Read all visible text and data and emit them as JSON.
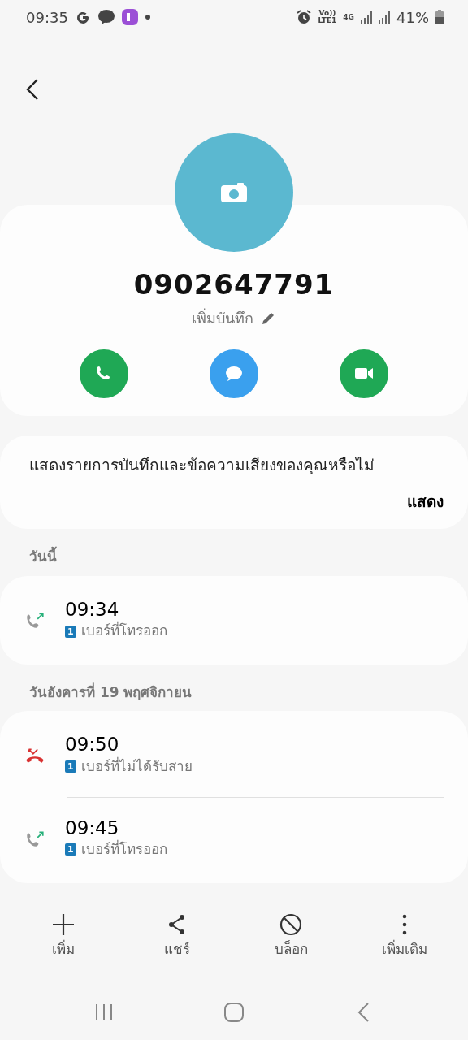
{
  "status_bar": {
    "time": "09:35",
    "volte": "Vo))",
    "lte": "LTE1",
    "network": "4G",
    "battery": "41%"
  },
  "contact": {
    "number": "0902647791",
    "add_note": "เพิ่มบันทึก"
  },
  "actions": [
    {
      "kind": "call"
    },
    {
      "kind": "message"
    },
    {
      "kind": "video"
    }
  ],
  "notice": {
    "text": "แสดงรายการบันทึกและข้อความเสียงของคุณหรือไม่",
    "button": "แสดง"
  },
  "call_groups": [
    {
      "heading": "วันนี้",
      "calls": [
        {
          "kind": "outgoing",
          "time": "09:34",
          "sim": "1",
          "label": "เบอร์ที่โทรออก"
        }
      ]
    },
    {
      "heading": "วันอังคารที่ 19 พฤศจิกายน",
      "calls": [
        {
          "kind": "missed",
          "time": "09:50",
          "sim": "1",
          "label": "เบอร์ที่ไม่ได้รับสาย"
        },
        {
          "kind": "outgoing",
          "time": "09:45",
          "sim": "1",
          "label": "เบอร์ที่โทรออก"
        }
      ]
    }
  ],
  "bottom_actions": [
    {
      "kind": "add",
      "label": "เพิ่ม"
    },
    {
      "kind": "share",
      "label": "แชร์"
    },
    {
      "kind": "block",
      "label": "บล็อก"
    },
    {
      "kind": "more",
      "label": "เพิ่มเติม"
    }
  ]
}
